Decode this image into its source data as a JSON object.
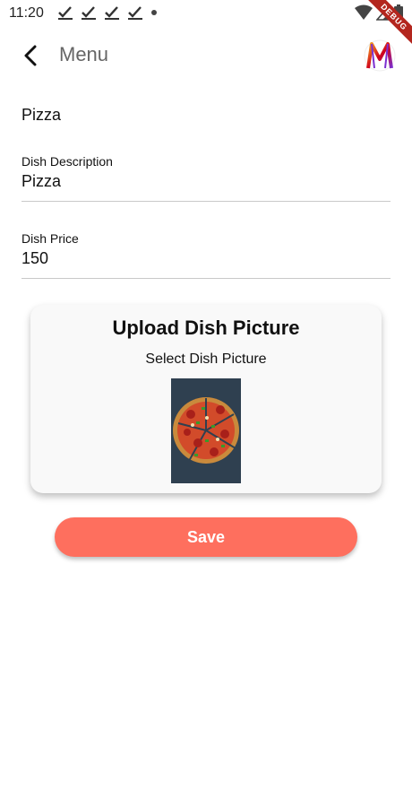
{
  "status_bar": {
    "time": "11:20",
    "notification_icons": [
      "check-notification-icon",
      "check-notification-icon",
      "check-notification-icon",
      "check-notification-icon"
    ],
    "indicator": "dot-icon",
    "right_icons": [
      "wifi-icon",
      "signal-icon",
      "battery-icon"
    ]
  },
  "debug_banner": {
    "text": "DEBUG"
  },
  "app_bar": {
    "title": "Menu",
    "back_icon": "back-arrow-icon",
    "logo": "app-logo-icon"
  },
  "dish": {
    "name": "Pizza"
  },
  "form": {
    "description": {
      "label": "Dish Description",
      "value": "Pizza"
    },
    "price": {
      "label": "Dish Price",
      "value": "150"
    }
  },
  "upload": {
    "title": "Upload Dish Picture",
    "select_label": "Select Dish Picture",
    "image_icon": "pizza-image"
  },
  "actions": {
    "save_label": "Save"
  },
  "colors": {
    "accent": "#fe6f5e",
    "title_gray": "#666666",
    "card_bg": "#f9f9f9",
    "divider": "#c9c9c9"
  }
}
